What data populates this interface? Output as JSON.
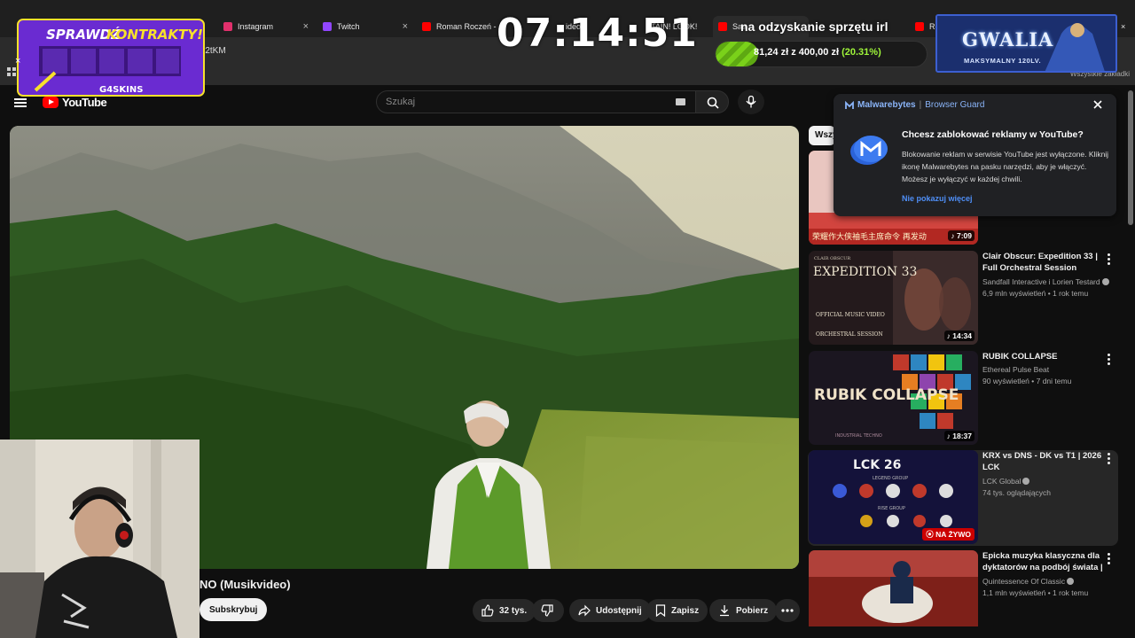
{
  "browser": {
    "tabs": [
      {
        "label": "Instagram",
        "favicon_color": "#e1306c"
      },
      {
        "label": "Twitch",
        "favicon_color": "#9146ff"
      },
      {
        "label": "Roman Roczeń -",
        "favicon_color": "#ff0000"
      },
      {
        "label": "ideo",
        "favicon_color": "#ff0000"
      },
      {
        "label": "TAIN! LOOK!",
        "favicon_color": "#ff0000"
      },
      {
        "label": "Saa",
        "favicon_color": "#ff0000"
      },
      {
        "label": "Rol",
        "favicon_color": "#ff0000"
      }
    ],
    "url_fragment": "r2tKM",
    "bookmarks_label": "Wszystkie zakładki"
  },
  "youtube": {
    "logo_text": "YouTube",
    "search_placeholder": "Szukaj",
    "video_title": "NO (Musikvideo)",
    "subscribe_label": "Subskrybuj",
    "actions": {
      "likes": "32 tys.",
      "share": "Udostępnij",
      "save": "Zapisz",
      "download": "Pobierz"
    },
    "chip_label": "Wszy",
    "recommendations": [
      {
        "title": "",
        "channel": "",
        "meta": "",
        "duration": "7:09",
        "live": false,
        "thumb_text": "荣耀作大侠袖毛主席命令 再发动"
      },
      {
        "title": "Clair Obscur: Expedition 33 | Full Orchestral Session [Officia...",
        "channel": "Sandfall Interactive i Lorien Testard",
        "meta": "6,9 mln wyświetleń • 1 rok temu",
        "duration": "14:34",
        "live": false,
        "thumb_text": "EXPEDITION 33",
        "thumb_sub": "OFFICIAL MUSIC VIDEO",
        "thumb_sub2": "ORCHESTRAL SESSION",
        "thumb_top": "CLAIR OBSCUR"
      },
      {
        "title": "RUBIK COLLAPSE",
        "channel": "Ethereal Pulse Beat",
        "meta": "90 wyświetleń • 7 dni temu",
        "duration": "18:37",
        "live": false,
        "thumb_text": "RUBIK COLLAPSE",
        "thumb_sub": "INDUSTRIAL TECHNO"
      },
      {
        "title": "KRX vs DNS - DK vs T1 | 2026 LCK",
        "channel": "LCK Global",
        "meta": "74 tys. oglądających",
        "duration": "NA ŻYWO",
        "live": true,
        "thumb_text": "LCK 26",
        "thumb_sub": "LEGEND GROUP",
        "thumb_sub2": "RISE GROUP"
      },
      {
        "title": "Epicka muzyka klasyczna dla dyktatorów na podbój świata | ...",
        "channel": "Quintessence Of Classic",
        "meta": "1,1 mln wyświetleń • 1 rok temu",
        "duration": "",
        "live": false
      }
    ]
  },
  "malwarebytes": {
    "brand": "Malwarebytes",
    "product": "Browser Guard",
    "title": "Chcesz zablokować reklamy w YouTube?",
    "body": "Blokowanie reklam w serwisie YouTube jest wyłączone. Kliknij ikonę Malwarebytes na pasku narzędzi, aby je włączyć. Możesz je wyłączyć w każdej chwili.",
    "link": "Nie pokazuj więcej"
  },
  "overlays": {
    "promo_title_part1": "SPRAWDŹ",
    "promo_title_part2": "KONTRAKTY!",
    "promo_brand": "G4SKINS",
    "clock": "07:14:51",
    "goal_label": "na odzyskanie sprzętu irl",
    "goal_current": "81,24 zł",
    "goal_separator": "z",
    "goal_target": "400,00 zł",
    "goal_percent": "(20.31%)",
    "goal_fraction": 0.2031,
    "sponsor_title": "GWALIA",
    "sponsor_subtitle": "MAKSYMALNY 120LV."
  },
  "colors": {
    "yt_red": "#ff0000",
    "link_blue": "#4f8ff7",
    "goal_green": "#7ad11a",
    "live_red": "#cc0000"
  }
}
